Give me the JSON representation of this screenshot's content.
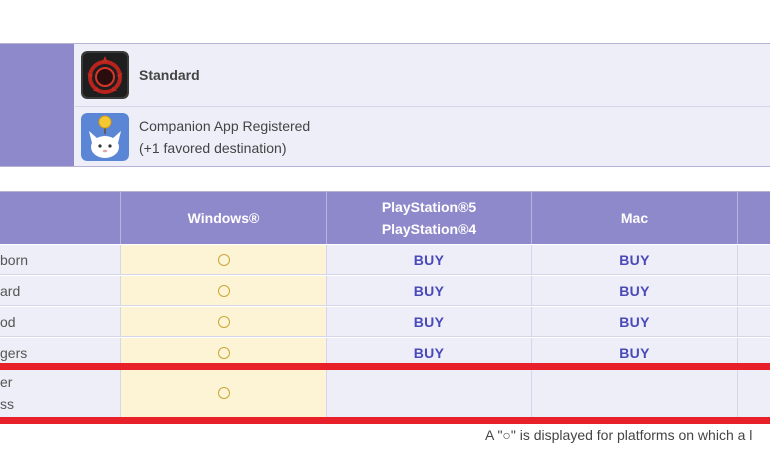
{
  "services": [
    {
      "icon": "meteor-sphere-icon",
      "label": "Standard",
      "bold": true
    },
    {
      "icon": "moogle-companion-icon",
      "line1": "Companion App Registered",
      "line2": "(+1 favored destination)"
    }
  ],
  "platforms_table": {
    "headers": {
      "windows": "Windows®",
      "playstation_line1": "PlayStation®5",
      "playstation_line2": "PlayStation®4",
      "mac": "Mac"
    },
    "rows": [
      {
        "label": "born",
        "windows": "○",
        "playstation": "BUY",
        "mac": "BUY"
      },
      {
        "label": "ard",
        "windows": "○",
        "playstation": "BUY",
        "mac": "BUY"
      },
      {
        "label": "od",
        "windows": "○",
        "playstation": "BUY",
        "mac": "BUY"
      },
      {
        "label": "gers",
        "windows": "○",
        "playstation": "BUY",
        "mac": "BUY"
      },
      {
        "label_line1": "er",
        "label_line2": "ss",
        "windows": "○",
        "playstation": "",
        "mac": ""
      }
    ]
  },
  "highlight_color": "#e8202a",
  "footnote": "A \"○\" is displayed for platforms on which a l"
}
